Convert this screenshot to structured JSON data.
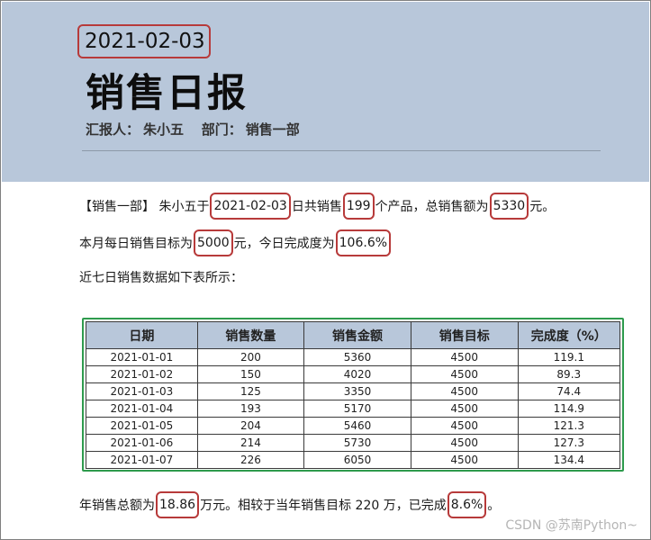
{
  "header": {
    "date": "2021-02-03",
    "title": "销售日报",
    "reporter_label": "汇报人：",
    "reporter_name": "朱小五",
    "dept_label": "部门：",
    "dept_name": "销售一部"
  },
  "summary": {
    "p1_prefix": "【销售一部】 朱小五于",
    "p1_date": "2021-02-03",
    "p1_mid1": "日共销售",
    "p1_count": "199",
    "p1_mid2": "个产品，总销售额为",
    "p1_amount": "5330",
    "p1_suffix": "元。",
    "p2_prefix": "本月每日销售目标为",
    "p2_target": "5000",
    "p2_mid": "元，今日完成度为",
    "p2_rate": "106.6%",
    "p3_text": "近七日销售数据如下表所示：",
    "p4_prefix": "年销售总额为",
    "p4_total": "18.86",
    "p4_mid": "万元。相较于当年销售目标 220 万，已完成",
    "p4_rate": "8.6%",
    "p4_suffix": "。"
  },
  "table": {
    "headers": [
      "日期",
      "销售数量",
      "销售金额",
      "销售目标",
      "完成度（%）"
    ],
    "rows": [
      [
        "2021-01-01",
        "200",
        "5360",
        "4500",
        "119.1"
      ],
      [
        "2021-01-02",
        "150",
        "4020",
        "4500",
        "89.3"
      ],
      [
        "2021-01-03",
        "125",
        "3350",
        "4500",
        "74.4"
      ],
      [
        "2021-01-04",
        "193",
        "5170",
        "4500",
        "114.9"
      ],
      [
        "2021-01-05",
        "204",
        "5460",
        "4500",
        "121.3"
      ],
      [
        "2021-01-06",
        "214",
        "5730",
        "4500",
        "127.3"
      ],
      [
        "2021-01-07",
        "226",
        "6050",
        "4500",
        "134.4"
      ]
    ]
  },
  "watermark": "CSDN @苏南Python~",
  "colors": {
    "header_bg": "#b8c7da",
    "highlight_border": "#b73a3a",
    "table_border": "#2e9b4d"
  }
}
